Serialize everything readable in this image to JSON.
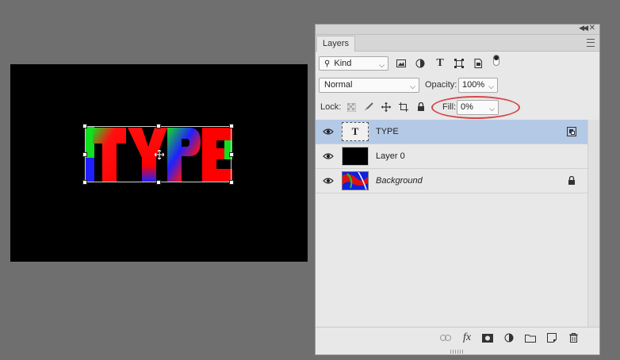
{
  "canvas": {
    "art_text": "TYPE"
  },
  "panel": {
    "tab_label": "Layers",
    "filter": {
      "kind_label": "Kind",
      "icons": [
        "image-filter-icon",
        "adjustment-filter-icon",
        "type-filter-icon",
        "shape-filter-icon",
        "smart-object-filter-icon",
        "filter-toggle-icon"
      ]
    },
    "blend_mode": "Normal",
    "opacity_label": "Opacity:",
    "opacity_value": "100%",
    "lock_label": "Lock:",
    "fill_label": "Fill:",
    "fill_value": "0%",
    "layers": [
      {
        "name": "TYPE",
        "kind": "type",
        "thumb_glyph": "T",
        "selected": true,
        "badge": "linked-smart-icon"
      },
      {
        "name": "Layer 0",
        "kind": "pixel",
        "selected": false
      },
      {
        "name": "Background",
        "kind": "background",
        "selected": false,
        "badge": "lock-icon"
      }
    ],
    "bottom_icons": [
      "link-layers-icon",
      "fx-icon",
      "add-mask-icon",
      "adjustment-layer-icon",
      "new-group-icon",
      "new-layer-icon",
      "delete-layer-icon"
    ],
    "fx_label": "fx"
  },
  "colors": {
    "selected_row": "#b3c9e6",
    "highlight_ellipse": "#d6474a",
    "canvas_bg": "#000000",
    "workspace_bg": "#6f6f6f"
  }
}
